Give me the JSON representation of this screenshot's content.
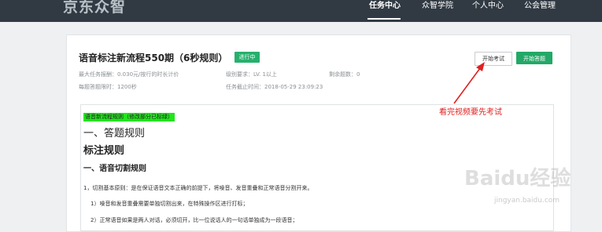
{
  "header": {
    "logo": "京东众智",
    "nav": [
      {
        "label": "任务中心",
        "active": true
      },
      {
        "label": "众智学院",
        "active": false
      },
      {
        "label": "个人中心",
        "active": false
      },
      {
        "label": "公会管理",
        "active": false
      }
    ]
  },
  "task": {
    "title": "语音标注新流程550期（6秒规则）",
    "status_badge": "进行中",
    "start_exam_button": "开始考试",
    "start_answer_button": "开始答题",
    "meta": {
      "max_reward": "最大任务报酬：0.030元/按行的时长计价",
      "level_req": "级别要求：LV. 1以上",
      "remaining": "剩余题数：0",
      "time_limit": "每题答题限时：1200秒",
      "deadline": "任务截止时间：2018-05-29 23:09:23"
    }
  },
  "content": {
    "highlight": "语音新流程规则（修改部分已标绿）",
    "section1": "一、答题规则",
    "section2": "标注规则",
    "section3": "一、语音切割规则",
    "paragraph1": "1，切割基本原则：是在保证语音文本正确的前提下，将噪音、发音重叠和正常语音分割开来。",
    "paragraph2": "1）噪音和发音重叠需要单独切割出来，在特殊操作区进行打标；",
    "paragraph3": "2）正常语音如果是两人对话，必须切开，比一位说话人的一句话单独成为一段语音；"
  },
  "annotation": {
    "text": "看完视频要先考试",
    "color": "#e02020"
  },
  "watermark": {
    "text": "Baidu经验",
    "sub": "jingyan.baidu.com"
  },
  "colors": {
    "header_bg": "#313a43",
    "accent_green": "#23a867",
    "highlight_green": "#22e51e"
  }
}
